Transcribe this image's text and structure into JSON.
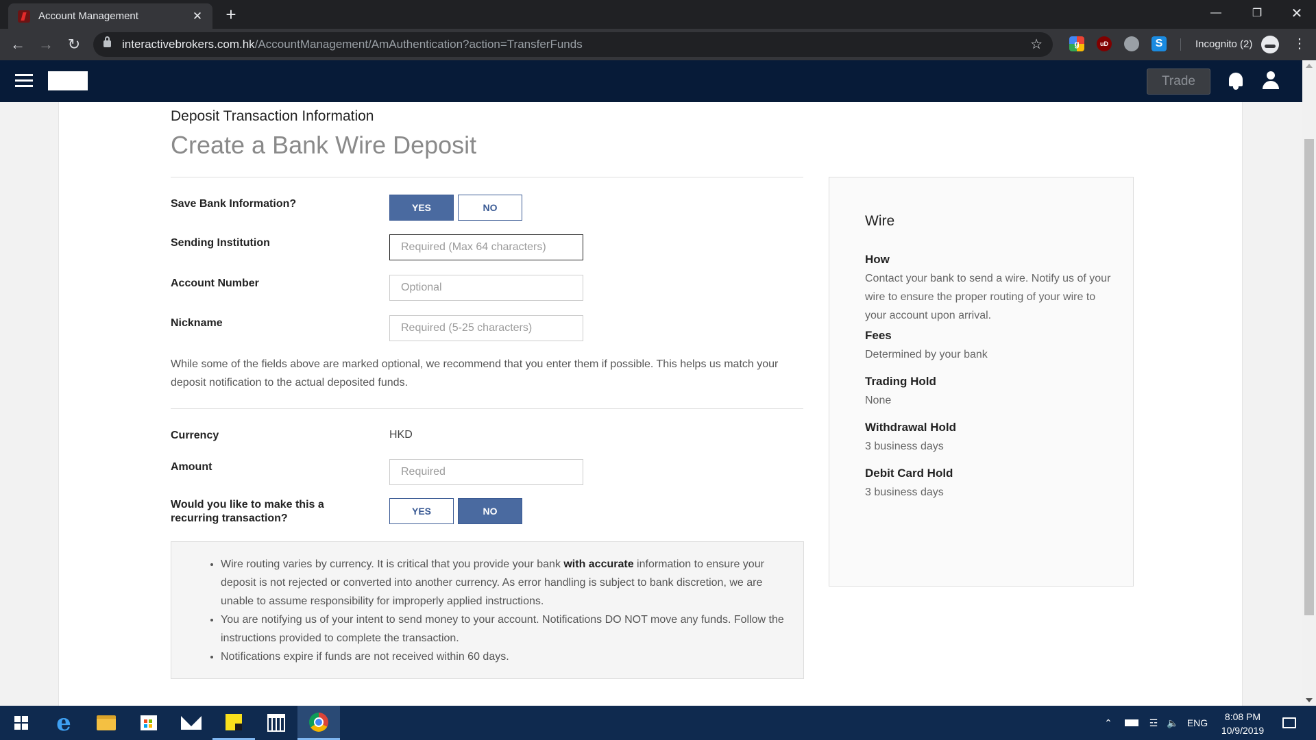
{
  "browser": {
    "tab_title": "Account Management",
    "url_host": "interactivebrokers.com.hk",
    "url_path": "/AccountManagement/AmAuthentication?action=TransferFunds",
    "incognito_label": "Incognito (2)"
  },
  "site": {
    "trade_label": "Trade"
  },
  "form": {
    "section_title": "Deposit Transaction Information",
    "page_title": "Create a Bank Wire Deposit",
    "save_bank_label": "Save Bank Information?",
    "save_yes": "YES",
    "save_no": "NO",
    "save_selected": "YES",
    "sending_label": "Sending Institution",
    "sending_placeholder": "Required (Max 64 characters)",
    "account_label": "Account Number",
    "account_placeholder": "Optional",
    "nickname_label": "Nickname",
    "nickname_placeholder": "Required (5-25 characters)",
    "note": "While some of the fields above are marked optional, we recommend that you enter them if possible. This helps us match your deposit notification to the actual deposited funds.",
    "currency_label": "Currency",
    "currency_value": "HKD",
    "amount_label": "Amount",
    "amount_placeholder": "Required",
    "recurring_label": "Would you like to make this a recurring transaction?",
    "recurring_yes": "YES",
    "recurring_no": "NO",
    "recurring_selected": "NO"
  },
  "notices": {
    "item1_before": "Wire routing varies by currency. It is critical that you provide your bank ",
    "item1_bold": "with accurate",
    "item1_after": " information to ensure your deposit is not rejected or converted into another currency. As error handling is subject to bank discretion, we are unable to assume responsibility for improperly applied instructions.",
    "item2": "You are notifying us of your intent to send money to your account. Notifications DO NOT move any funds. Follow the instructions provided to complete the transaction.",
    "item3": "Notifications expire if funds are not received within 60 days."
  },
  "sidebar": {
    "title": "Wire",
    "how_heading": "How",
    "how_text": "Contact your bank to send a wire. Notify us of your wire to ensure the proper routing of your wire to your account upon arrival.",
    "fees_heading": "Fees",
    "fees_text": "Determined by your bank",
    "trading_hold_heading": "Trading Hold",
    "trading_hold_text": "None",
    "withdrawal_hold_heading": "Withdrawal Hold",
    "withdrawal_hold_text": "3 business days",
    "debit_hold_heading": "Debit Card Hold",
    "debit_hold_text": "3 business days"
  },
  "taskbar": {
    "language": "ENG",
    "time": "8:08 PM",
    "date": "10/9/2019",
    "items": [
      "windows-start",
      "edge",
      "file-explorer",
      "store",
      "mail",
      "sticky-notes",
      "calendar",
      "chrome"
    ]
  },
  "colors": {
    "header_bg": "#071b38",
    "toggle_selected": "#4a6aa0",
    "taskbar_bg": "#0f2a4f"
  }
}
